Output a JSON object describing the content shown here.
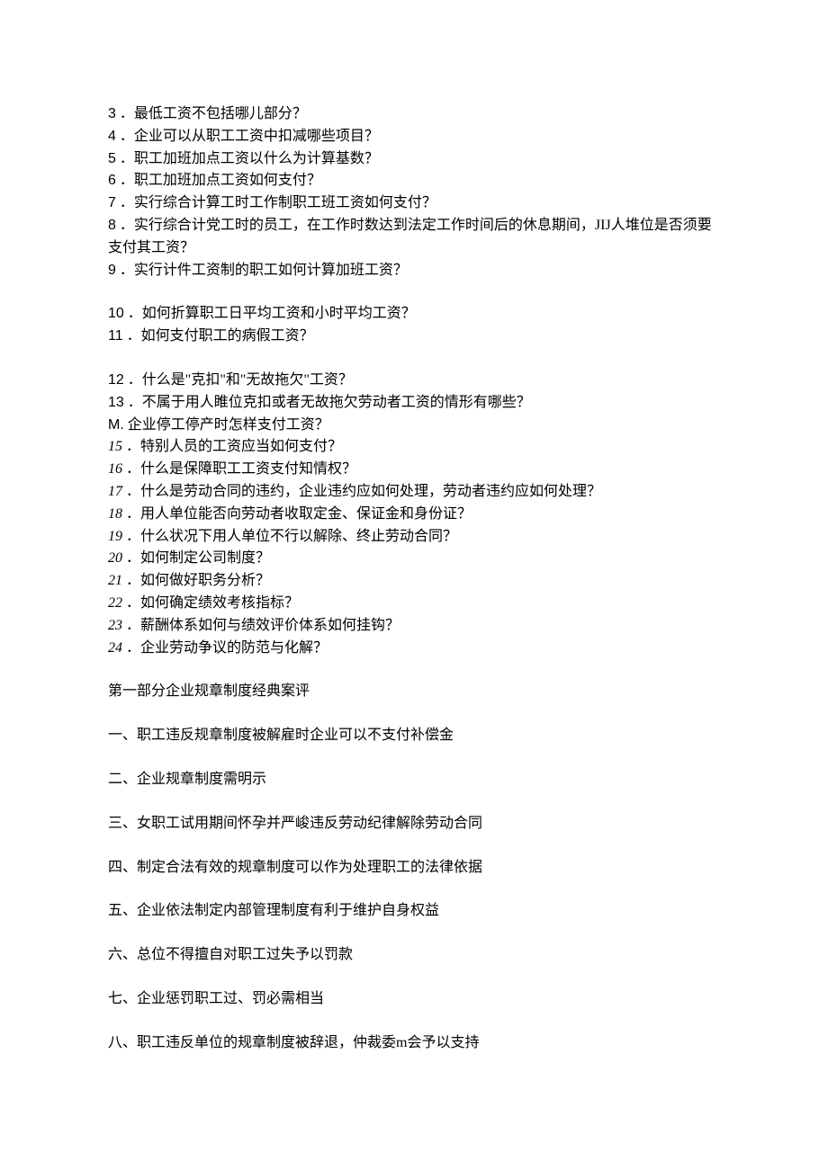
{
  "numbered": [
    {
      "n": "3",
      "t": "．最低工资不包括哪儿部分？",
      "cls": "num"
    },
    {
      "n": "4",
      "t": "．企业可以从职工工资中扣减哪些项目？",
      "cls": "num"
    },
    {
      "n": "5",
      "t": "．职工加班加点工资以什么为计算基数？",
      "cls": "num"
    },
    {
      "n": "6",
      "t": "．职工加班加点工资如何支付？",
      "cls": "num"
    },
    {
      "n": "7",
      "t": "．实行综合计算工时工作制职工班工资如何支付？",
      "cls": "num"
    },
    {
      "n": "8",
      "t": "．实行综合计党工时的员工，在工作时数达到法定工作时间后的休息期间，JIJ人堆位是否须要支付其工资？",
      "cls": "num"
    },
    {
      "n": "9",
      "t": "．实行计件工资制的职工如何计算加班工资？",
      "cls": "num"
    }
  ],
  "numbered2": [
    {
      "n": "10",
      "t": "．如何折算职工日平均工资和小时平均工资？",
      "cls": "num"
    },
    {
      "n": "11",
      "t": "．如何支付职工的病假工资？",
      "cls": "num"
    }
  ],
  "numbered3": [
    {
      "n": "12",
      "t": "．什么是\"克扣\"和\"无故拖欠\"工资？",
      "cls": "num"
    },
    {
      "n": "13",
      "t": "．不属于用人睢位克扣或者无故拖欠劳动者工资的情形有哪些？",
      "cls": "num"
    },
    {
      "n": "M.",
      "t": " 企业停工停产时怎样支付工资？",
      "cls": "num",
      "nospace": true
    }
  ],
  "italic": [
    {
      "n": "15",
      "t": "．特别人员的工资应当如何支付？"
    },
    {
      "n": "16",
      "t": "．什么是保障职工工资支付知情权？"
    },
    {
      "n": "17",
      "t": "．什么是劳动合同的违约，企业违约应如何处理，劳动者违约应如何处理？"
    },
    {
      "n": "18",
      "t": "．用人单位能否向劳动者收取定金、保证金和身份证？"
    },
    {
      "n": "19",
      "t": "．什么状况下用人单位不行以解除、终止劳动合同？"
    },
    {
      "n": "20",
      "t": "．如何制定公司制度？"
    },
    {
      "n": "21",
      "t": "．如何做好职务分析？"
    },
    {
      "n": "22",
      "t": "．如何确定绩效考核指标？"
    },
    {
      "n": "23",
      "t": "．薪酬体系如何与绩效评价体系如何挂钩？"
    },
    {
      "n": "24",
      "t": "．企业劳动争议的防范与化解？"
    }
  ],
  "section_heading": "第一部分企业规章制度经典案评",
  "cases": [
    "一、职工违反规章制度被解雇时企业可以不支付补偿金",
    "二、企业规章制度需明示",
    "三、女职工试用期间怀孕并严峻违反劳动纪律解除劳动合同",
    "四、制定合法有效的规章制度可以作为处理职工的法律依据",
    "五、企业依法制定内部管理制度有利于维护自身权益",
    "六、总位不得擅自对职工过失予以罚款",
    "七、企业惩罚职工过、罚必需相当",
    "八、职工违反单位的规章制度被辞退，仲裁委m会予以支持"
  ]
}
